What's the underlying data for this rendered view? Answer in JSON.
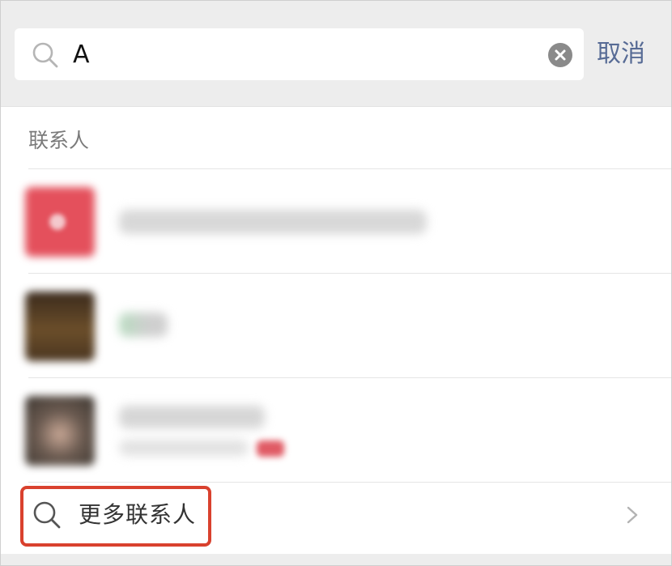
{
  "search": {
    "value": "A",
    "cancel_label": "取消"
  },
  "contacts_section": {
    "title": "联系人",
    "rows": [
      {
        "avatar_color": "#e4505c",
        "blurred": true
      },
      {
        "avatar_color": "#5a4228",
        "blurred": true
      },
      {
        "avatar_color": "#6e6a62",
        "blurred": true
      }
    ]
  },
  "more_contacts": {
    "label": "更多联系人"
  },
  "icons": {
    "search": "search-icon",
    "clear": "clear-icon",
    "chevron": "chevron-right-icon"
  },
  "colors": {
    "link_blue": "#576b95",
    "highlight_red": "#d9412e",
    "header_gray": "#ededed"
  }
}
